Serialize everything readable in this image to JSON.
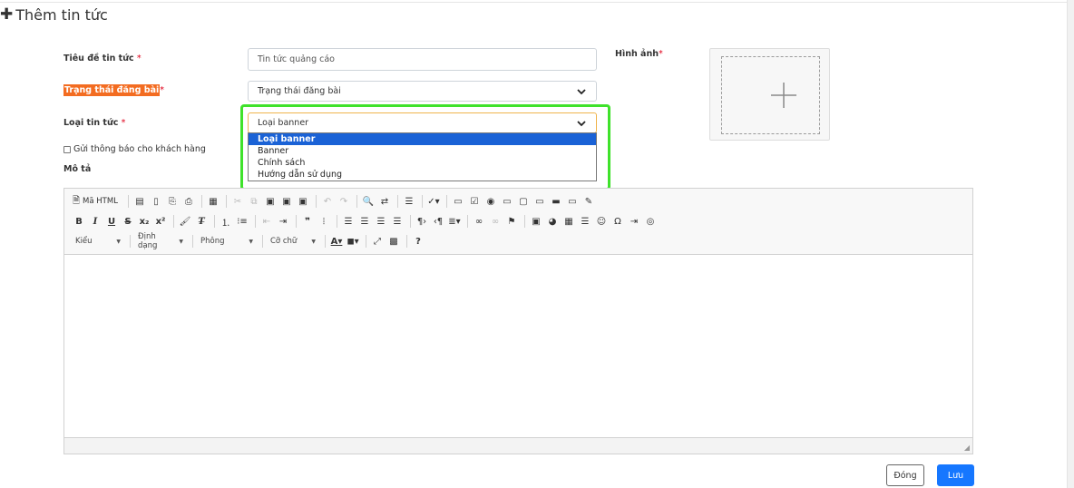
{
  "page": {
    "title": "Thêm tin tức",
    "title_icon": "plus-icon"
  },
  "form": {
    "title_field": {
      "label": "Tiêu đề tin tức",
      "required_mark": "*",
      "value": "Tin tức quảng cáo"
    },
    "status_field": {
      "label": "Trạng thái đăng bài",
      "required_mark": "*",
      "value": "Trạng thái đăng bài"
    },
    "type_field": {
      "label": "Loại tin tức",
      "required_mark": "*",
      "value": "Loại banner",
      "options": [
        "Loại banner",
        "Banner",
        "Chính sách",
        "Hướng dẫn sử dụng"
      ],
      "selected_index": 0
    },
    "notify_checkbox": {
      "label": "Gửi thông báo cho khách hàng",
      "checked": false
    },
    "description": {
      "label": "Mô tả"
    },
    "image": {
      "label": "Hình ảnh",
      "required_mark": "*"
    }
  },
  "editor": {
    "source_label": "Mã HTML",
    "styles_combo": "Kiểu",
    "format_combo": "Định dạng",
    "font_combo": "Phông",
    "size_combo": "Cỡ chữ",
    "help_label": "?"
  },
  "actions": {
    "close_label": "Đóng",
    "save_label": "Lưu"
  },
  "colors": {
    "accent": "#1677ff",
    "highlight": "#3fe22b",
    "label_highlight": "#f36c21",
    "dropdown_selected": "#1a62d6"
  }
}
